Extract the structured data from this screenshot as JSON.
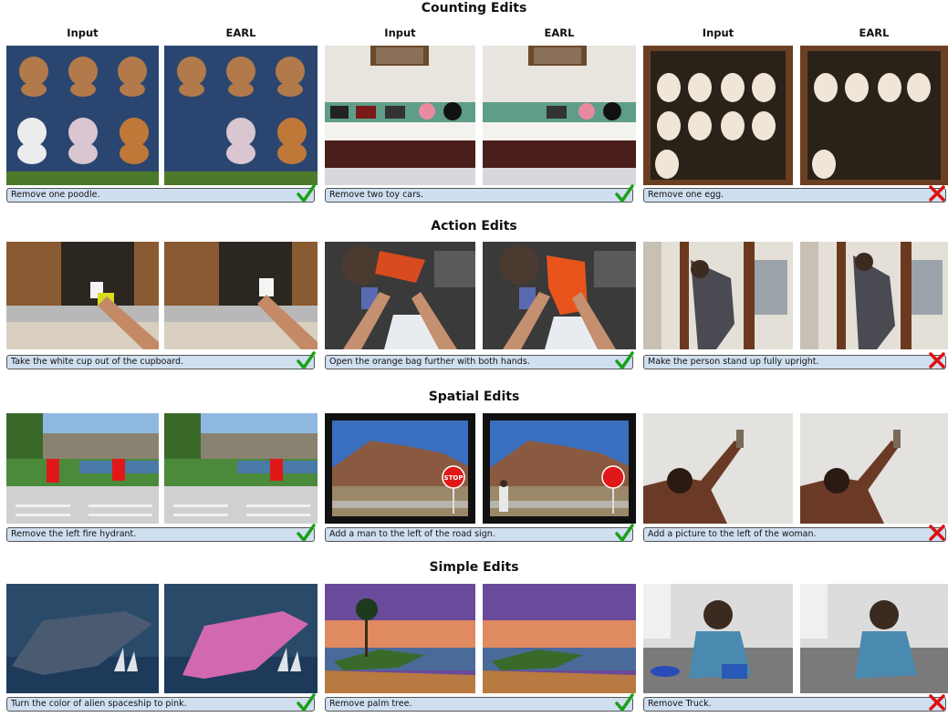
{
  "sections": [
    {
      "title": "Counting Edits",
      "headers": [
        "Input",
        "EARL",
        "Input",
        "EARL",
        "Input",
        "EARL"
      ],
      "captions": [
        {
          "text": "Remove one poodle.",
          "result": "success"
        },
        {
          "text": "Remove two toy cars.",
          "result": "success"
        },
        {
          "text": "Remove one egg.",
          "result": "failure"
        }
      ]
    },
    {
      "title": "Action Edits",
      "captions": [
        {
          "text": "Take the white cup out of the cupboard.",
          "result": "success"
        },
        {
          "text": "Open the orange bag further with both hands.",
          "result": "success"
        },
        {
          "text": "Make the person stand up fully upright.",
          "result": "failure"
        }
      ]
    },
    {
      "title": "Spatial Edits",
      "captions": [
        {
          "text": "Remove the left fire hydrant.",
          "result": "success"
        },
        {
          "text": "Add a man to the left of the road sign.",
          "result": "success"
        },
        {
          "text": "Add a picture to the left of the woman.",
          "result": "failure"
        }
      ],
      "sign_text": "STOP"
    },
    {
      "title": "Simple Edits",
      "captions": [
        {
          "text": "Turn the color of alien spaceship to pink.",
          "result": "success"
        },
        {
          "text": "Remove palm tree.",
          "result": "success"
        },
        {
          "text": "Remove Truck.",
          "result": "failure"
        }
      ]
    }
  ],
  "colors": {
    "caption_bg": "#cfdff0",
    "check": "#1aa01a",
    "cross": "#e01010"
  },
  "icons": {
    "success": "check-icon",
    "failure": "cross-icon"
  }
}
